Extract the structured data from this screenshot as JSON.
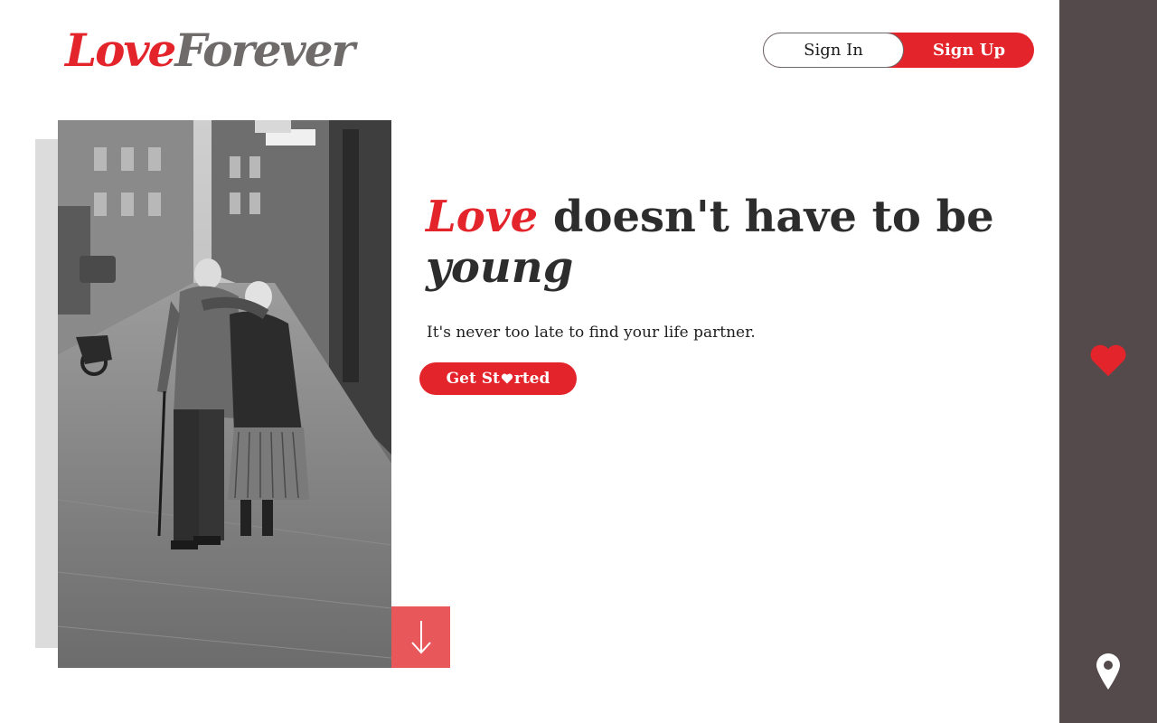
{
  "brand": {
    "logo_part1": "Love",
    "logo_part2": "Forever",
    "accent_color": "#e3242b"
  },
  "header": {
    "signin_label": "Sign In",
    "signup_label": "Sign Up"
  },
  "hero": {
    "headline_accent": "Love",
    "headline_main": " doesn't have to be",
    "headline_second": "young",
    "subtitle": "It's never too late to find your life partner.",
    "cta_prefix": "Get St",
    "cta_suffix": "rted"
  },
  "photo": {
    "description_icon": "elderly-couple-photo"
  },
  "scroll": {
    "icon": "arrow-down-icon"
  },
  "side_rail": {
    "color": "#544a4b",
    "icons": [
      "heart-icon",
      "location-pin-icon"
    ]
  }
}
